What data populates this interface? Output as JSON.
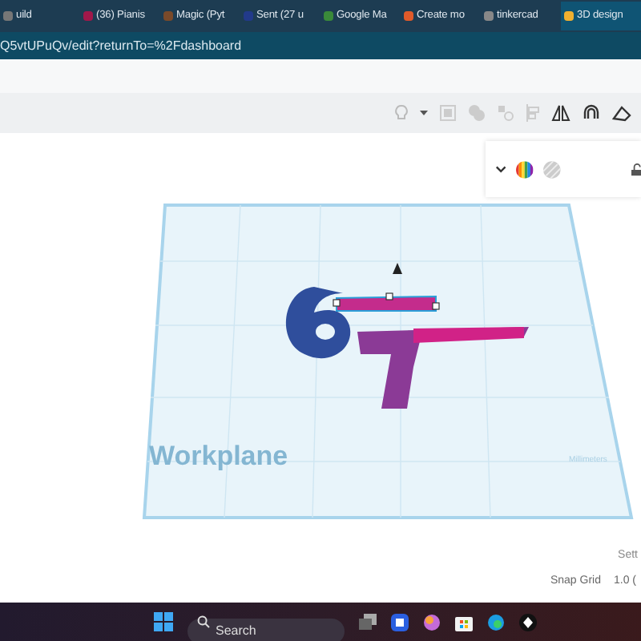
{
  "browser": {
    "tabs": [
      {
        "label": "uild",
        "selected": false
      },
      {
        "label": "(36) Pianis",
        "selected": false
      },
      {
        "label": "Magic (Pyt",
        "selected": false
      },
      {
        "label": "Sent (27 u",
        "selected": false
      },
      {
        "label": "Google Ma",
        "selected": false
      },
      {
        "label": "Create mo",
        "selected": false
      },
      {
        "label": "tinkercad",
        "selected": false
      },
      {
        "label": "3D design",
        "selected": true
      }
    ],
    "address": "Q5vtUPuQv/edit?returnTo=%2Fdashboard"
  },
  "workplane": {
    "label": "Workplane",
    "units": "Millimeters"
  },
  "settings": {
    "label": "Sett",
    "snap_grid_label": "Snap Grid",
    "snap_grid_value": "1.0 ("
  },
  "taskbar": {
    "search_placeholder": "Search"
  }
}
